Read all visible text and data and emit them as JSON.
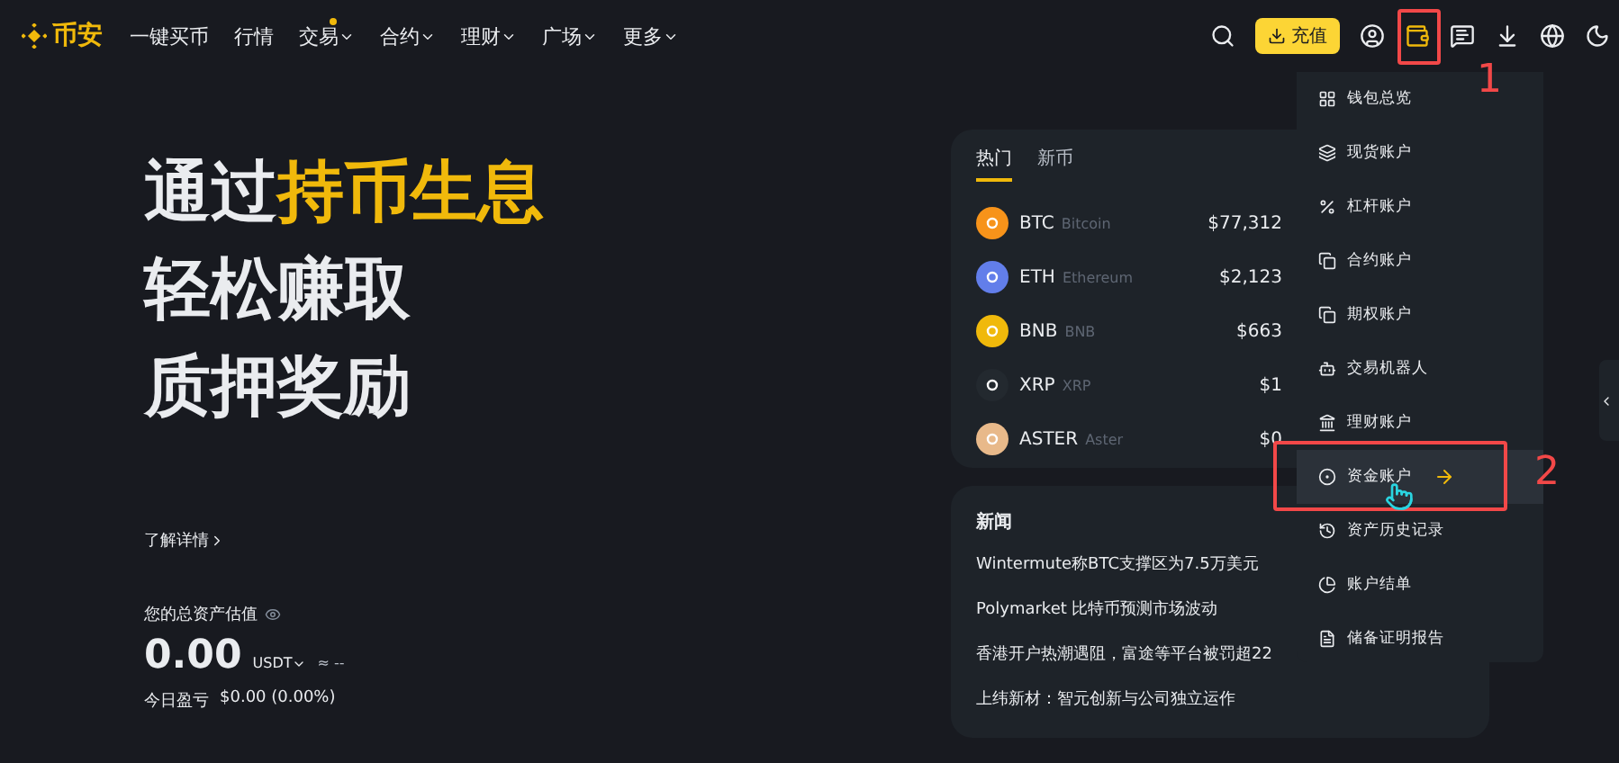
{
  "nav": {
    "logo": "币安",
    "items": [
      {
        "label": "一键买币",
        "dropdown": false,
        "dot": false
      },
      {
        "label": "行情",
        "dropdown": false,
        "dot": false
      },
      {
        "label": "交易",
        "dropdown": true,
        "dot": true
      },
      {
        "label": "合约",
        "dropdown": true,
        "dot": false
      },
      {
        "label": "理财",
        "dropdown": true,
        "dot": false
      },
      {
        "label": "广场",
        "dropdown": true,
        "dot": false
      },
      {
        "label": "更多",
        "dropdown": true,
        "dot": false
      }
    ],
    "deposit_button": "充值",
    "icons": [
      {
        "kind": "user",
        "selected": false
      },
      {
        "kind": "wallet",
        "selected": true
      },
      {
        "kind": "message",
        "selected": false
      },
      {
        "kind": "download",
        "selected": false
      },
      {
        "kind": "globe",
        "selected": false
      },
      {
        "kind": "moon",
        "selected": false
      }
    ]
  },
  "hero": {
    "title_lines": [
      [
        {
          "text": "通过",
          "highlight": false
        },
        {
          "text": "持币生息",
          "highlight": true
        }
      ],
      [
        {
          "text": "轻松赚取",
          "highlight": false
        }
      ],
      [
        {
          "text": "质押奖励",
          "highlight": false
        }
      ]
    ],
    "learn_more": "了解详情",
    "balance_label": "您的总资产估值",
    "balance": "0.00",
    "currency": "USDT",
    "approx": "≈ --",
    "pnl_label": "今日盈亏",
    "pnl": "$0.00 (0.00%)"
  },
  "markets": {
    "tabs": [
      {
        "label": "热门",
        "selected": true
      },
      {
        "label": "新币",
        "selected": false
      }
    ],
    "rows": [
      {
        "symbol": "BTC",
        "name": "Bitcoin",
        "price": "$77,312",
        "color": "#f7931a"
      },
      {
        "symbol": "ETH",
        "name": "Ethereum",
        "price": "$2,123",
        "color": "#627eea"
      },
      {
        "symbol": "BNB",
        "name": "BNB",
        "price": "$663",
        "color": "#f0b90b"
      },
      {
        "symbol": "XRP",
        "name": "XRP",
        "price": "$1",
        "color": "#23292f"
      },
      {
        "symbol": "ASTER",
        "name": "Aster",
        "price": "$0",
        "color": "#e8b98a"
      }
    ]
  },
  "news": {
    "title": "新闻",
    "items": [
      "Wintermute称BTC支撑区为7.5万美元",
      "Polymarket 比特币预测市场波动",
      "香港开户热潮遇阻，富途等平台被罚超22",
      "上纬新材：智元创新与公司独立运作"
    ]
  },
  "wallet_menu": [
    {
      "label": "钱包总览",
      "kind": "grid",
      "hovered": false
    },
    {
      "label": "现货账户",
      "kind": "spot",
      "hovered": false
    },
    {
      "label": "杠杆账户",
      "kind": "percent",
      "hovered": false
    },
    {
      "label": "合约账户",
      "kind": "futures",
      "hovered": false
    },
    {
      "label": "期权账户",
      "kind": "options",
      "hovered": false
    },
    {
      "label": "交易机器人",
      "kind": "bot",
      "hovered": false
    },
    {
      "label": "理财账户",
      "kind": "earn",
      "hovered": false
    },
    {
      "label": "资金账户",
      "kind": "funding",
      "hovered": true
    },
    {
      "label": "资产历史记录",
      "kind": "history",
      "hovered": false
    },
    {
      "label": "账户结单",
      "kind": "pie",
      "hovered": false
    },
    {
      "label": "储备证明报告",
      "kind": "doc",
      "hovered": false
    }
  ],
  "annotations": [
    "1",
    "2"
  ]
}
